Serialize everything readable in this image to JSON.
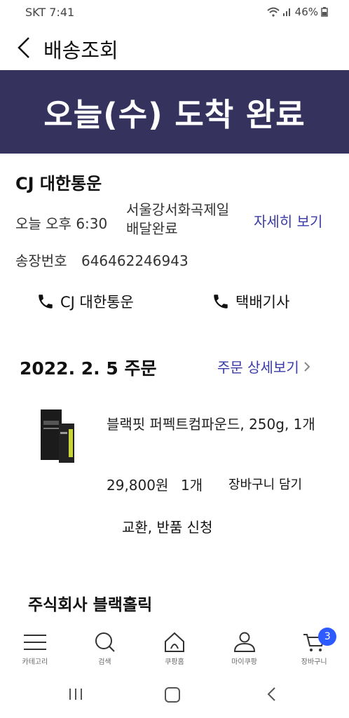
{
  "status": {
    "carrier": "SKT 7:41",
    "battery": "46%"
  },
  "header": {
    "title": "배송조회"
  },
  "banner": {
    "text": "오늘(수) 도착 완료"
  },
  "delivery": {
    "carrier_name": "CJ 대한통운",
    "time": "오늘 오후 6:30",
    "location": "서울강서화곡제일 배달완료",
    "detail_link": "자세히 보기",
    "tracking_label": "송장번호",
    "tracking_number": "646462246943",
    "call_carrier": "CJ 대한통운",
    "call_driver": "택배기사"
  },
  "order": {
    "date": "2022. 2. 5 주문",
    "detail_link": "주문 상세보기",
    "product_name": "블랙핏 퍼펙트컴파운드, 250g, 1개",
    "price": "29,800원",
    "qty": "1개",
    "cart_add": "장바구니 담기",
    "exchange": "교환, 반품 신청"
  },
  "seller": {
    "name": "주식회사 블랙홀릭"
  },
  "bottom_nav": {
    "items": [
      {
        "label": "카테고리",
        "icon": "menu-icon"
      },
      {
        "label": "검색",
        "icon": "search-icon"
      },
      {
        "label": "쿠팡홈",
        "icon": "home-icon"
      },
      {
        "label": "마이쿠팡",
        "icon": "user-icon"
      },
      {
        "label": "장바구니",
        "icon": "cart-icon"
      }
    ],
    "cart_badge": "3"
  }
}
